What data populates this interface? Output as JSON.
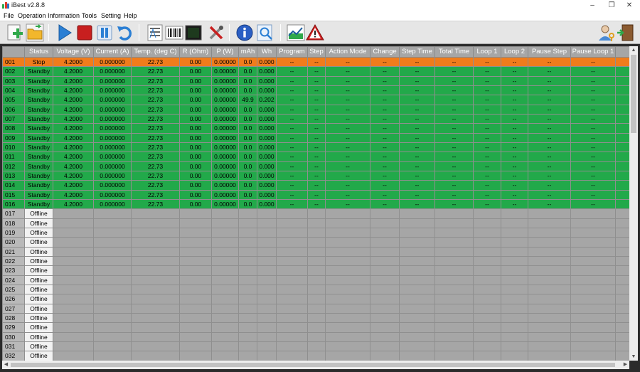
{
  "window": {
    "title": "iBest v2.8.8",
    "controls": [
      "–",
      "❐",
      "✕"
    ]
  },
  "menu": [
    "File",
    "Operation",
    "Information",
    "Tools",
    "Setting",
    "Help"
  ],
  "toolbar": {
    "icons": [
      "new-plus-icon",
      "open-folder-icon",
      "play-icon",
      "stop-icon",
      "pause-icon",
      "undo-icon",
      "list-icon",
      "barcode-icon",
      "terminal-icon",
      "tools-icon",
      "info-icon",
      "search-doc-icon",
      "chart-icon",
      "warning-icon",
      "user-key-icon",
      "exit-door-icon"
    ]
  },
  "grid": {
    "columns": [
      "",
      "Status",
      "Voltage (V)",
      "Current (A)",
      "Temp. (deg C)",
      "R (Ohm)",
      "P (W)",
      "mAh",
      "Wh",
      "Program",
      "Step",
      "Action Mode",
      "Change",
      "Step Time",
      "Total Time",
      "Loop 1",
      "Loop 2",
      "Pause Step",
      "Pause Loop 1",
      "Pau"
    ],
    "rows": [
      {
        "state": "stop",
        "cells": [
          "001",
          "Stop",
          "4.2000",
          "0.000000",
          "22.73",
          "0.00",
          "0.00000",
          "0.0",
          "0.000",
          "--",
          "--",
          "--",
          "--",
          "--",
          "--",
          "--",
          "--",
          "--",
          "--",
          ""
        ]
      },
      {
        "state": "standby",
        "cells": [
          "002",
          "Standby",
          "4.2000",
          "0.000000",
          "22.73",
          "0.00",
          "0.00000",
          "0.0",
          "0.000",
          "--",
          "--",
          "--",
          "--",
          "--",
          "--",
          "--",
          "--",
          "--",
          "--",
          ""
        ]
      },
      {
        "state": "standby",
        "cells": [
          "003",
          "Standby",
          "4.2000",
          "0.000000",
          "22.73",
          "0.00",
          "0.00000",
          "0.0",
          "0.000",
          "--",
          "--",
          "--",
          "--",
          "--",
          "--",
          "--",
          "--",
          "--",
          "--",
          ""
        ]
      },
      {
        "state": "standby",
        "cells": [
          "004",
          "Standby",
          "4.2000",
          "0.000000",
          "22.73",
          "0.00",
          "0.00000",
          "0.0",
          "0.000",
          "--",
          "--",
          "--",
          "--",
          "--",
          "--",
          "--",
          "--",
          "--",
          "--",
          ""
        ]
      },
      {
        "state": "standby",
        "cells": [
          "005",
          "Standby",
          "4.2000",
          "0.000000",
          "22.73",
          "0.00",
          "0.00000",
          "49.9",
          "0.202",
          "--",
          "--",
          "--",
          "--",
          "--",
          "--",
          "--",
          "--",
          "--",
          "--",
          ""
        ]
      },
      {
        "state": "standby",
        "cells": [
          "006",
          "Standby",
          "4.2000",
          "0.000000",
          "22.73",
          "0.00",
          "0.00000",
          "0.0",
          "0.000",
          "--",
          "--",
          "--",
          "--",
          "--",
          "--",
          "--",
          "--",
          "--",
          "--",
          ""
        ]
      },
      {
        "state": "standby",
        "cells": [
          "007",
          "Standby",
          "4.2000",
          "0.000000",
          "22.73",
          "0.00",
          "0.00000",
          "0.0",
          "0.000",
          "--",
          "--",
          "--",
          "--",
          "--",
          "--",
          "--",
          "--",
          "--",
          "--",
          ""
        ]
      },
      {
        "state": "standby",
        "cells": [
          "008",
          "Standby",
          "4.2000",
          "0.000000",
          "22.73",
          "0.00",
          "0.00000",
          "0.0",
          "0.000",
          "--",
          "--",
          "--",
          "--",
          "--",
          "--",
          "--",
          "--",
          "--",
          "--",
          ""
        ]
      },
      {
        "state": "standby",
        "cells": [
          "009",
          "Standby",
          "4.2000",
          "0.000000",
          "22.73",
          "0.00",
          "0.00000",
          "0.0",
          "0.000",
          "--",
          "--",
          "--",
          "--",
          "--",
          "--",
          "--",
          "--",
          "--",
          "--",
          ""
        ]
      },
      {
        "state": "standby",
        "cells": [
          "010",
          "Standby",
          "4.2000",
          "0.000000",
          "22.73",
          "0.00",
          "0.00000",
          "0.0",
          "0.000",
          "--",
          "--",
          "--",
          "--",
          "--",
          "--",
          "--",
          "--",
          "--",
          "--",
          ""
        ]
      },
      {
        "state": "standby",
        "cells": [
          "011",
          "Standby",
          "4.2000",
          "0.000000",
          "22.73",
          "0.00",
          "0.00000",
          "0.0",
          "0.000",
          "--",
          "--",
          "--",
          "--",
          "--",
          "--",
          "--",
          "--",
          "--",
          "--",
          ""
        ]
      },
      {
        "state": "standby",
        "cells": [
          "012",
          "Standby",
          "4.2000",
          "0.000000",
          "22.73",
          "0.00",
          "0.00000",
          "0.0",
          "0.000",
          "--",
          "--",
          "--",
          "--",
          "--",
          "--",
          "--",
          "--",
          "--",
          "--",
          ""
        ]
      },
      {
        "state": "standby",
        "cells": [
          "013",
          "Standby",
          "4.2000",
          "0.000000",
          "22.73",
          "0.00",
          "0.00000",
          "0.0",
          "0.000",
          "--",
          "--",
          "--",
          "--",
          "--",
          "--",
          "--",
          "--",
          "--",
          "--",
          ""
        ]
      },
      {
        "state": "standby",
        "cells": [
          "014",
          "Standby",
          "4.2000",
          "0.000000",
          "22.73",
          "0.00",
          "0.00000",
          "0.0",
          "0.000",
          "--",
          "--",
          "--",
          "--",
          "--",
          "--",
          "--",
          "--",
          "--",
          "--",
          ""
        ]
      },
      {
        "state": "standby",
        "cells": [
          "015",
          "Standby",
          "4.2000",
          "0.000000",
          "22.73",
          "0.00",
          "0.00000",
          "0.0",
          "0.000",
          "--",
          "--",
          "--",
          "--",
          "--",
          "--",
          "--",
          "--",
          "--",
          "--",
          ""
        ]
      },
      {
        "state": "standby",
        "cells": [
          "016",
          "Standby",
          "4.2000",
          "0.000000",
          "22.73",
          "0.00",
          "0.00000",
          "0.0",
          "0.000",
          "--",
          "--",
          "--",
          "--",
          "--",
          "--",
          "--",
          "--",
          "--",
          "--",
          ""
        ]
      },
      {
        "state": "offline",
        "cells": [
          "017",
          "Offline",
          "",
          "",
          "",
          "",
          "",
          "",
          "",
          "",
          "",
          "",
          "",
          "",
          "",
          "",
          "",
          "",
          "",
          ""
        ]
      },
      {
        "state": "offline",
        "cells": [
          "018",
          "Offline",
          "",
          "",
          "",
          "",
          "",
          "",
          "",
          "",
          "",
          "",
          "",
          "",
          "",
          "",
          "",
          "",
          "",
          ""
        ]
      },
      {
        "state": "offline",
        "cells": [
          "019",
          "Offline",
          "",
          "",
          "",
          "",
          "",
          "",
          "",
          "",
          "",
          "",
          "",
          "",
          "",
          "",
          "",
          "",
          "",
          ""
        ]
      },
      {
        "state": "offline",
        "cells": [
          "020",
          "Offline",
          "",
          "",
          "",
          "",
          "",
          "",
          "",
          "",
          "",
          "",
          "",
          "",
          "",
          "",
          "",
          "",
          "",
          ""
        ]
      },
      {
        "state": "offline",
        "cells": [
          "021",
          "Offline",
          "",
          "",
          "",
          "",
          "",
          "",
          "",
          "",
          "",
          "",
          "",
          "",
          "",
          "",
          "",
          "",
          "",
          ""
        ]
      },
      {
        "state": "offline",
        "cells": [
          "022",
          "Offline",
          "",
          "",
          "",
          "",
          "",
          "",
          "",
          "",
          "",
          "",
          "",
          "",
          "",
          "",
          "",
          "",
          "",
          ""
        ]
      },
      {
        "state": "offline",
        "cells": [
          "023",
          "Offline",
          "",
          "",
          "",
          "",
          "",
          "",
          "",
          "",
          "",
          "",
          "",
          "",
          "",
          "",
          "",
          "",
          "",
          ""
        ]
      },
      {
        "state": "offline",
        "cells": [
          "024",
          "Offline",
          "",
          "",
          "",
          "",
          "",
          "",
          "",
          "",
          "",
          "",
          "",
          "",
          "",
          "",
          "",
          "",
          "",
          ""
        ]
      },
      {
        "state": "offline",
        "cells": [
          "025",
          "Offline",
          "",
          "",
          "",
          "",
          "",
          "",
          "",
          "",
          "",
          "",
          "",
          "",
          "",
          "",
          "",
          "",
          "",
          ""
        ]
      },
      {
        "state": "offline",
        "cells": [
          "026",
          "Offline",
          "",
          "",
          "",
          "",
          "",
          "",
          "",
          "",
          "",
          "",
          "",
          "",
          "",
          "",
          "",
          "",
          "",
          ""
        ]
      },
      {
        "state": "offline",
        "cells": [
          "027",
          "Offline",
          "",
          "",
          "",
          "",
          "",
          "",
          "",
          "",
          "",
          "",
          "",
          "",
          "",
          "",
          "",
          "",
          "",
          ""
        ]
      },
      {
        "state": "offline",
        "cells": [
          "028",
          "Offline",
          "",
          "",
          "",
          "",
          "",
          "",
          "",
          "",
          "",
          "",
          "",
          "",
          "",
          "",
          "",
          "",
          "",
          ""
        ]
      },
      {
        "state": "offline",
        "cells": [
          "029",
          "Offline",
          "",
          "",
          "",
          "",
          "",
          "",
          "",
          "",
          "",
          "",
          "",
          "",
          "",
          "",
          "",
          "",
          "",
          ""
        ]
      },
      {
        "state": "offline",
        "cells": [
          "030",
          "Offline",
          "",
          "",
          "",
          "",
          "",
          "",
          "",
          "",
          "",
          "",
          "",
          "",
          "",
          "",
          "",
          "",
          "",
          ""
        ]
      },
      {
        "state": "offline",
        "cells": [
          "031",
          "Offline",
          "",
          "",
          "",
          "",
          "",
          "",
          "",
          "",
          "",
          "",
          "",
          "",
          "",
          "",
          "",
          "",
          "",
          ""
        ]
      },
      {
        "state": "offline",
        "cells": [
          "032",
          "Offline",
          "",
          "",
          "",
          "",
          "",
          "",
          "",
          "",
          "",
          "",
          "",
          "",
          "",
          "",
          "",
          "",
          "",
          ""
        ]
      }
    ]
  },
  "colors": {
    "stop": "#f07c1c",
    "standby": "#22a94a",
    "offline": "#a6a6a6",
    "header": "#a6a6a6"
  }
}
